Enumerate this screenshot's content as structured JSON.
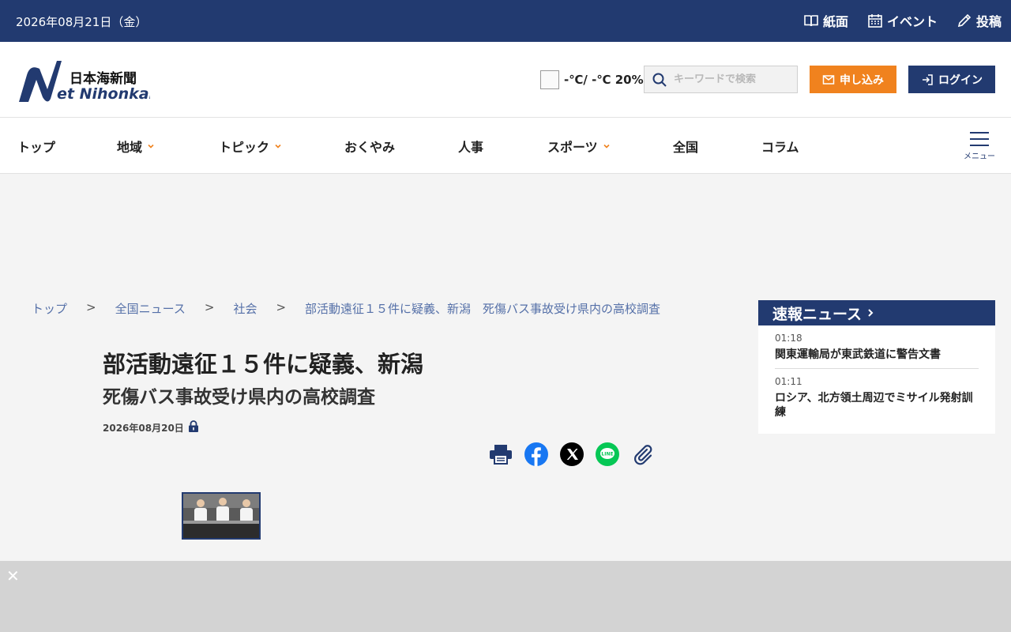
{
  "topbar": {
    "date": "2026年08月21日（金）",
    "links": [
      {
        "label": "紙面",
        "icon": "book-icon"
      },
      {
        "label": "イベント",
        "icon": "calendar-icon"
      },
      {
        "label": "投稿",
        "icon": "pen-icon"
      }
    ]
  },
  "header": {
    "logo_text_jp": "日本海新聞",
    "logo_text_en": "Net Nihonkai",
    "weather": "-℃/ -℃ 20%",
    "search_placeholder": "キーワードで検索",
    "subscribe_label": "申し込み",
    "login_label": "ログイン"
  },
  "nav": {
    "items": [
      {
        "label": "トップ"
      },
      {
        "label": "地域"
      },
      {
        "label": "トピック"
      },
      {
        "label": "おくやみ"
      },
      {
        "label": "人事"
      },
      {
        "label": "スポーツ"
      },
      {
        "label": "全国"
      },
      {
        "label": "コラム"
      }
    ],
    "menu_label": "メニュー"
  },
  "breadcrumb": [
    "トップ",
    "全国ニュース",
    "社会",
    "部活動遠征１５件に疑義、新潟　死傷バス事故受け県内の高校調査"
  ],
  "breadcrumb_sep": ">",
  "article": {
    "headline": "部活動遠征１５件に疑義、新潟",
    "subheadline": "死傷バス事故受け県内の高校調査",
    "date": "2026年08月20日",
    "share_icons": [
      "print-icon",
      "facebook-icon",
      "x-icon",
      "line-icon",
      "link-icon"
    ]
  },
  "sidebar": {
    "title": "速報ニュース",
    "items": [
      {
        "time": "01:18",
        "title": "関東運輸局が東武鉄道に警告文書"
      },
      {
        "time": "01:11",
        "title": "ロシア、北方領土周辺でミサイル発射訓練"
      }
    ]
  },
  "overlay": {
    "close": "✕"
  },
  "colors": {
    "navy": "#223a70",
    "orange": "#f0821e",
    "link": "#5570a8"
  }
}
